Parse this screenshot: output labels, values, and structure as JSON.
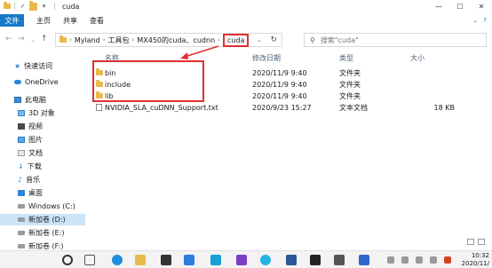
{
  "window": {
    "title": "cuda",
    "controls": {
      "minimize": "—",
      "maximize": "☐",
      "close": "✕"
    }
  },
  "ribbon": {
    "file_tab": "文件",
    "tabs": [
      "主页",
      "共享",
      "查看"
    ]
  },
  "address": {
    "crumbs": [
      "Myland",
      "工具包",
      "MX450的cuda、cudnn"
    ],
    "current": "cuda"
  },
  "search": {
    "placeholder": "搜索\"cuda\""
  },
  "nav_pane": [
    {
      "label": "快速访问",
      "icon": "star-icon"
    },
    {
      "label": "OneDrive",
      "icon": "cloud-icon"
    },
    {
      "label": "此电脑",
      "icon": "pc-icon"
    },
    {
      "label": "3D 对象",
      "icon": "cube-icon"
    },
    {
      "label": "视频",
      "icon": "video-icon"
    },
    {
      "label": "图片",
      "icon": "picture-icon"
    },
    {
      "label": "文档",
      "icon": "document-icon"
    },
    {
      "label": "下载",
      "icon": "download-icon"
    },
    {
      "label": "音乐",
      "icon": "music-icon"
    },
    {
      "label": "桌面",
      "icon": "desktop-icon"
    },
    {
      "label": "Windows (C:)",
      "icon": "drive-icon"
    },
    {
      "label": "新加卷 (D:)",
      "icon": "drive-icon",
      "selected": true
    },
    {
      "label": "新加卷 (E:)",
      "icon": "drive-icon"
    },
    {
      "label": "新加卷 (F:)",
      "icon": "drive-icon"
    }
  ],
  "columns": {
    "name": "名称",
    "date": "修改日期",
    "type": "类型",
    "size": "大小"
  },
  "files": [
    {
      "name": "bin",
      "date": "2020/11/9 9:40",
      "type": "文件夹",
      "size": "",
      "icon": "folder-icon"
    },
    {
      "name": "include",
      "date": "2020/11/9 9:40",
      "type": "文件夹",
      "size": "",
      "icon": "folder-icon"
    },
    {
      "name": "lib",
      "date": "2020/11/9 9:40",
      "type": "文件夹",
      "size": "",
      "icon": "folder-icon"
    },
    {
      "name": "NVIDIA_SLA_cuDNN_Support.txt",
      "date": "2020/9/23 15:27",
      "type": "文本文档",
      "size": "18 KB",
      "icon": "text-file-icon"
    }
  ],
  "taskbar": {
    "time": "10:32",
    "date": "2020/11/"
  },
  "colors": {
    "accent": "#1979ca",
    "highlight": "#e03030",
    "folder": "#e9b94a",
    "selection": "#cce4f7"
  }
}
